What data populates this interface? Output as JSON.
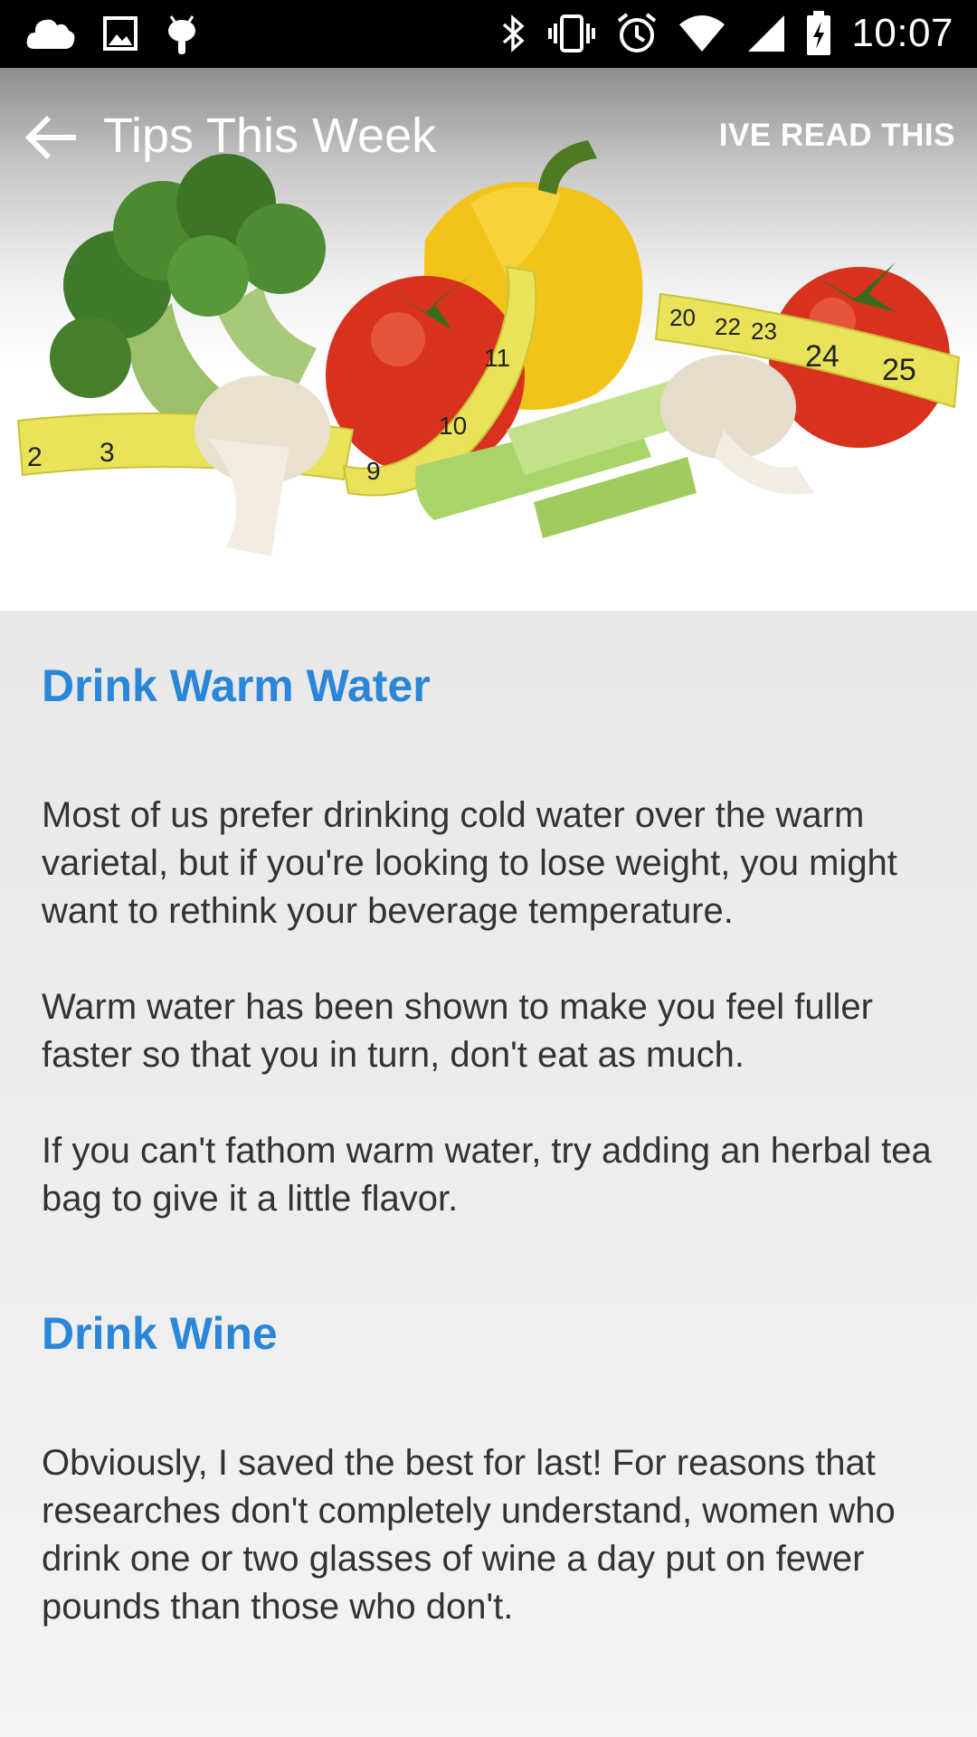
{
  "status_bar": {
    "time": "10:07",
    "left_icons": [
      "cloud-icon",
      "image-icon",
      "android-debug-icon"
    ],
    "right_icons": [
      "bluetooth-icon",
      "vibrate-icon",
      "alarm-icon",
      "wifi-icon",
      "signal-icon",
      "battery-charging-icon"
    ]
  },
  "app_bar": {
    "title": "Tips This Week",
    "action_label": "IVE READ THIS",
    "back_icon": "arrow-back-icon"
  },
  "hero": {
    "image_desc_icon": "vegetables-measuring-tape-image"
  },
  "tips": [
    {
      "title": "Drink Warm Water",
      "paragraphs": [
        "Most of us prefer drinking cold water over the warm varietal, but if you're looking to lose weight, you might want to rethink your beverage temperature.",
        "Warm water has been shown to make you feel fuller faster so that you in turn, don't eat as much.",
        "If you can't fathom warm water, try adding an herbal tea bag to give it a little flavor."
      ]
    },
    {
      "title": "Drink Wine",
      "paragraphs": [
        "Obviously, I saved the best for last! For reasons that researches don't completely understand, women who drink one or two glasses of wine a day put on fewer pounds than those who don't."
      ]
    }
  ],
  "colors": {
    "accent": "#2a86d8",
    "body_text": "#333333",
    "status_bar": "#000000",
    "content_bg": "#efefef"
  }
}
